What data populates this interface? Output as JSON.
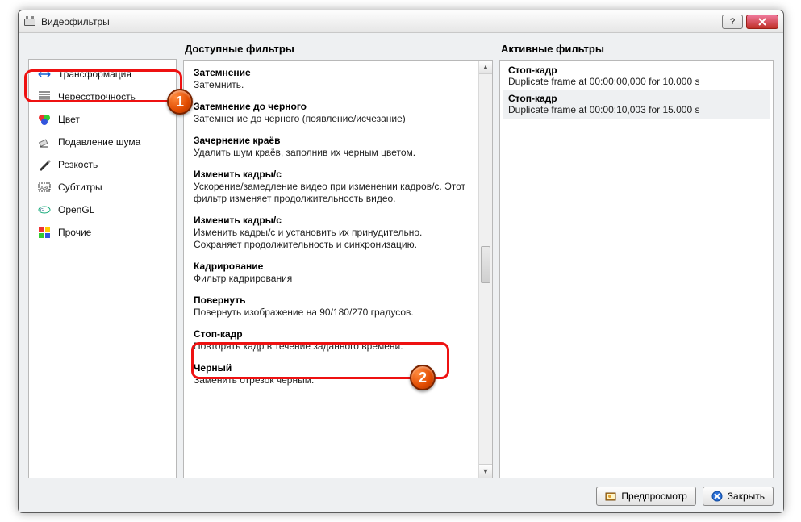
{
  "window": {
    "title": "Видеофильтры"
  },
  "headers": {
    "available": "Доступные фильтры",
    "active": "Активные фильтры"
  },
  "categories": [
    {
      "id": "transform",
      "label": "Трансформация",
      "icon": "transform",
      "selected": true
    },
    {
      "id": "interlace",
      "label": "Чересстрочность",
      "icon": "interlace",
      "selected": false
    },
    {
      "id": "color",
      "label": "Цвет",
      "icon": "color",
      "selected": false
    },
    {
      "id": "denoise",
      "label": "Подавление шума",
      "icon": "eraser",
      "selected": false
    },
    {
      "id": "sharpen",
      "label": "Резкость",
      "icon": "pen",
      "selected": false
    },
    {
      "id": "subtitles",
      "label": "Субтитры",
      "icon": "subtitles",
      "selected": false
    },
    {
      "id": "opengl",
      "label": "OpenGL",
      "icon": "opengl",
      "selected": false
    },
    {
      "id": "misc",
      "label": "Прочие",
      "icon": "misc",
      "selected": false
    }
  ],
  "filters": [
    {
      "name": "Затемнение",
      "desc": "Затемнить."
    },
    {
      "name": "Затемнение до черного",
      "desc": "Затемнение до черного (появление/исчезание)"
    },
    {
      "name": "Зачернение краёв",
      "desc": "Удалить шум краёв, заполнив их черным цветом."
    },
    {
      "name": "Изменить кадры/с",
      "desc": "Ускорение/замедление видео при изменении кадров/с. Этот фильтр изменяет продолжительность видео."
    },
    {
      "name": "Изменить кадры/с",
      "desc": "Изменить кадры/с и установить их принудительно. Сохраняет продолжительность и синхронизацию."
    },
    {
      "name": "Кадрирование",
      "desc": "Фильтр кадрирования"
    },
    {
      "name": "Повернуть",
      "desc": "Повернуть изображение на 90/180/270 градусов."
    },
    {
      "name": "Стоп-кадр",
      "desc": "Повторять кадр в течение заданного времени.",
      "highlight": true
    },
    {
      "name": "Черный",
      "desc": "Заменить отрезок черным."
    }
  ],
  "active_filters": [
    {
      "name": "Стоп-кадр",
      "desc": "Duplicate frame at 00:00:00,000 for 10.000 s",
      "selected": false
    },
    {
      "name": "Стоп-кадр",
      "desc": "Duplicate frame at 00:00:10,003 for 15.000 s",
      "selected": true
    }
  ],
  "buttons": {
    "preview": "Предпросмотр",
    "close": "Закрыть"
  },
  "annotations": {
    "badge1": "1",
    "badge2": "2"
  }
}
